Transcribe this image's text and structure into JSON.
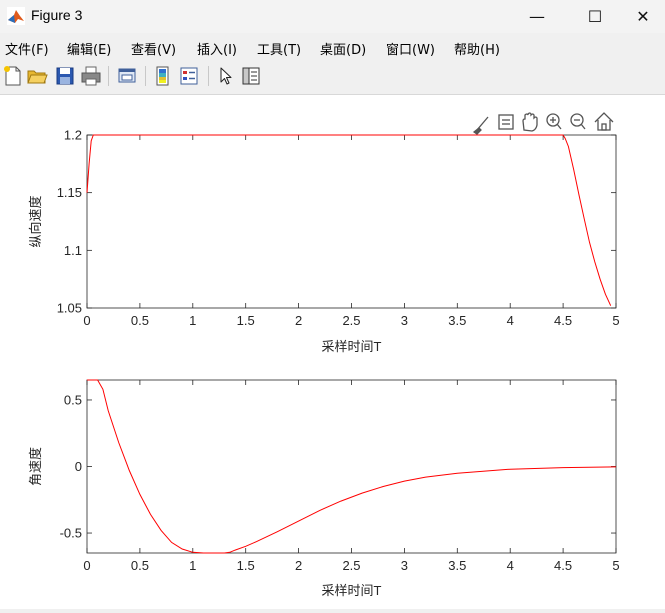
{
  "window": {
    "title": "Figure 3",
    "minimize": "—",
    "maximize": "☐",
    "close": "✕"
  },
  "menu": [
    "文件(F)",
    "编辑(E)",
    "查看(V)",
    "插入(I)",
    "工具(T)",
    "桌面(D)",
    "窗口(W)",
    "帮助(H)"
  ],
  "toolbar_icons": [
    "new-figure-icon",
    "open-file-icon",
    "save-icon",
    "print-icon",
    "link-plot-icon",
    "insert-colorbar-icon",
    "insert-legend-icon",
    "edit-plot-icon",
    "property-inspector-icon"
  ],
  "axes_toolbar_icons": [
    "brush-icon",
    "data-tip-icon",
    "pan-icon",
    "zoom-in-icon",
    "zoom-out-icon",
    "home-icon"
  ],
  "colors": {
    "line": "#ff0000",
    "axis": "#262626"
  },
  "chart_data": [
    {
      "type": "line",
      "title": "",
      "xlabel": "采样时间T",
      "ylabel": "纵向速度",
      "xlim": [
        0,
        5
      ],
      "ylim": [
        1.05,
        1.2
      ],
      "xticks": [
        0,
        0.5,
        1,
        1.5,
        2,
        2.5,
        3,
        3.5,
        4,
        4.5,
        5
      ],
      "xtick_labels": [
        "0",
        "0.5",
        "1",
        "1.5",
        "2",
        "2.5",
        "3",
        "3.5",
        "4",
        "4.5",
        "5"
      ],
      "yticks": [
        1.05,
        1.1,
        1.15,
        1.2
      ],
      "ytick_labels": [
        "1.05",
        "1.1",
        "1.15",
        "1.2"
      ],
      "grid": false,
      "series": [
        {
          "color": "#ff0000",
          "x": [
            0,
            0.02,
            0.04,
            0.06,
            0.1,
            1.0,
            2.0,
            3.0,
            4.0,
            4.5,
            4.52,
            4.55,
            4.6,
            4.65,
            4.7,
            4.75,
            4.8,
            4.85,
            4.9,
            4.95
          ],
          "y": [
            1.15,
            1.175,
            1.195,
            1.2,
            1.2,
            1.2,
            1.2,
            1.2,
            1.2,
            1.2,
            1.197,
            1.19,
            1.17,
            1.148,
            1.127,
            1.107,
            1.09,
            1.075,
            1.062,
            1.052
          ]
        }
      ]
    },
    {
      "type": "line",
      "title": "",
      "xlabel": "采样时间T",
      "ylabel": "角速度",
      "xlim": [
        0,
        5
      ],
      "ylim": [
        -0.65,
        0.65
      ],
      "xticks": [
        0,
        0.5,
        1,
        1.5,
        2,
        2.5,
        3,
        3.5,
        4,
        4.5,
        5
      ],
      "xtick_labels": [
        "0",
        "0.5",
        "1",
        "1.5",
        "2",
        "2.5",
        "3",
        "3.5",
        "4",
        "4.5",
        "5"
      ],
      "yticks": [
        -0.5,
        0,
        0.5
      ],
      "ytick_labels": [
        "-0.5",
        "0",
        "0.5"
      ],
      "grid": false,
      "series": [
        {
          "color": "#ff0000",
          "x": [
            0,
            0.1,
            0.15,
            0.2,
            0.3,
            0.4,
            0.5,
            0.6,
            0.7,
            0.8,
            0.9,
            1.0,
            1.1,
            1.2,
            1.3,
            1.35,
            1.4,
            1.5,
            1.6,
            1.8,
            2.0,
            2.2,
            2.4,
            2.6,
            2.8,
            3.0,
            3.2,
            3.5,
            4.0,
            4.5,
            5.0
          ],
          "y": [
            0.65,
            0.65,
            0.58,
            0.42,
            0.18,
            -0.03,
            -0.21,
            -0.36,
            -0.48,
            -0.57,
            -0.62,
            -0.645,
            -0.65,
            -0.65,
            -0.65,
            -0.645,
            -0.628,
            -0.6,
            -0.565,
            -0.49,
            -0.41,
            -0.33,
            -0.26,
            -0.2,
            -0.15,
            -0.11,
            -0.08,
            -0.05,
            -0.02,
            -0.008,
            -0.003
          ]
        }
      ]
    }
  ]
}
